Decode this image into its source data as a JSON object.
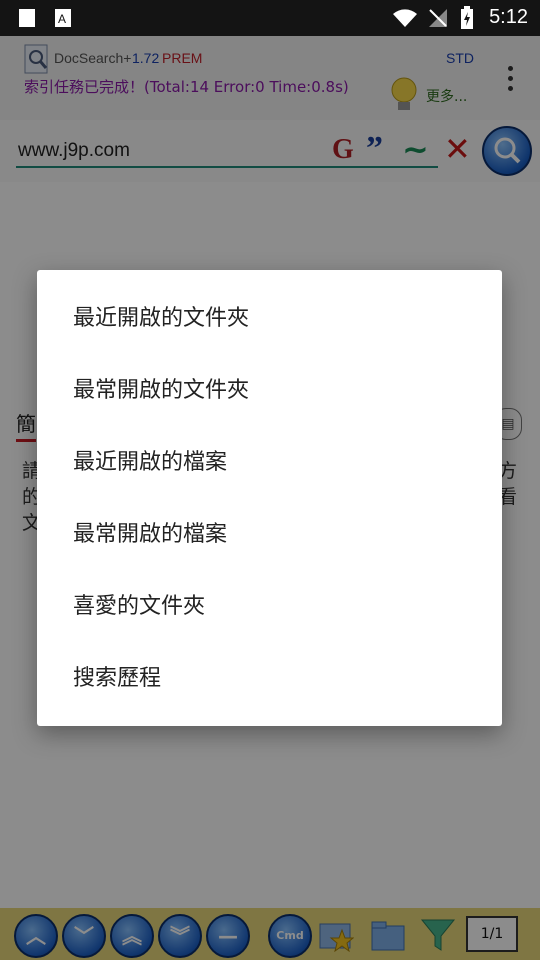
{
  "status_bar": {
    "time": "5:12"
  },
  "header": {
    "app_name": "DocSearch+",
    "version": "1.72",
    "edition": "PREM",
    "mode": "STD",
    "status_message": "索引任務已完成！(Total:14 Error:0 Time:0.8s)",
    "more_label": "更多..."
  },
  "search": {
    "query": "www.j9p.com"
  },
  "search_tools": {
    "g": "G",
    "quote": "”",
    "tilde": "~",
    "clear": "✕"
  },
  "main": {
    "tab_label": "簡",
    "help_left": "請的文",
    "help_right": "方看"
  },
  "dialog": {
    "items": [
      {
        "label": "最近開啟的文件夾"
      },
      {
        "label": "最常開啟的文件夾"
      },
      {
        "label": "最近開啟的檔案"
      },
      {
        "label": "最常開啟的檔案"
      },
      {
        "label": "喜愛的文件夾"
      },
      {
        "label": "搜索歷程"
      }
    ]
  },
  "toolbar": {
    "cmd_label": "Cmd",
    "page_label": "1/1"
  }
}
